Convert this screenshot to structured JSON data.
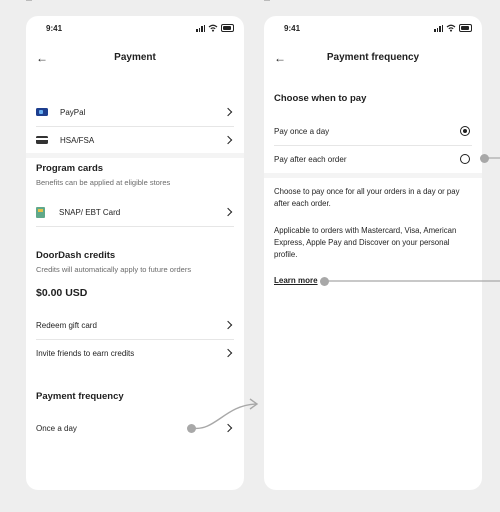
{
  "status_bar": {
    "time": "9:41"
  },
  "left_screen": {
    "title": "Payment",
    "payment_methods": [
      {
        "label": "PayPal",
        "icon": "paypal-icon"
      },
      {
        "label": "HSA/FSA",
        "icon": "card-icon"
      }
    ],
    "program_cards": {
      "heading": "Program cards",
      "subtitle": "Benefits can be applied at eligible stores",
      "item": {
        "label": "SNAP/ EBT Card",
        "icon": "snap-card-icon"
      }
    },
    "credits": {
      "heading": "DoorDash credits",
      "subtitle": "Credits will automatically apply to future orders",
      "amount": "$0.00 USD",
      "items": [
        {
          "label": "Redeem gift card"
        },
        {
          "label": "Invite friends to earn credits"
        }
      ]
    },
    "payment_frequency": {
      "heading": "Payment frequency",
      "value": "Once a day"
    }
  },
  "right_screen": {
    "title": "Payment frequency",
    "heading": "Choose when to pay",
    "options": [
      {
        "label": "Pay once a day",
        "selected": true
      },
      {
        "label": "Pay after each order",
        "selected": false
      }
    ],
    "description_1": "Choose to pay once for all your orders in a day or pay after each order.",
    "description_2": "Applicable to orders with Mastercard, Visa, American Express, Apple Pay and Discover on your personal profile.",
    "learn_more": "Learn more"
  },
  "colors": {
    "page_bg": "#eeeeee",
    "screen_bg": "#ffffff",
    "annotation": "#a8a8a8"
  }
}
